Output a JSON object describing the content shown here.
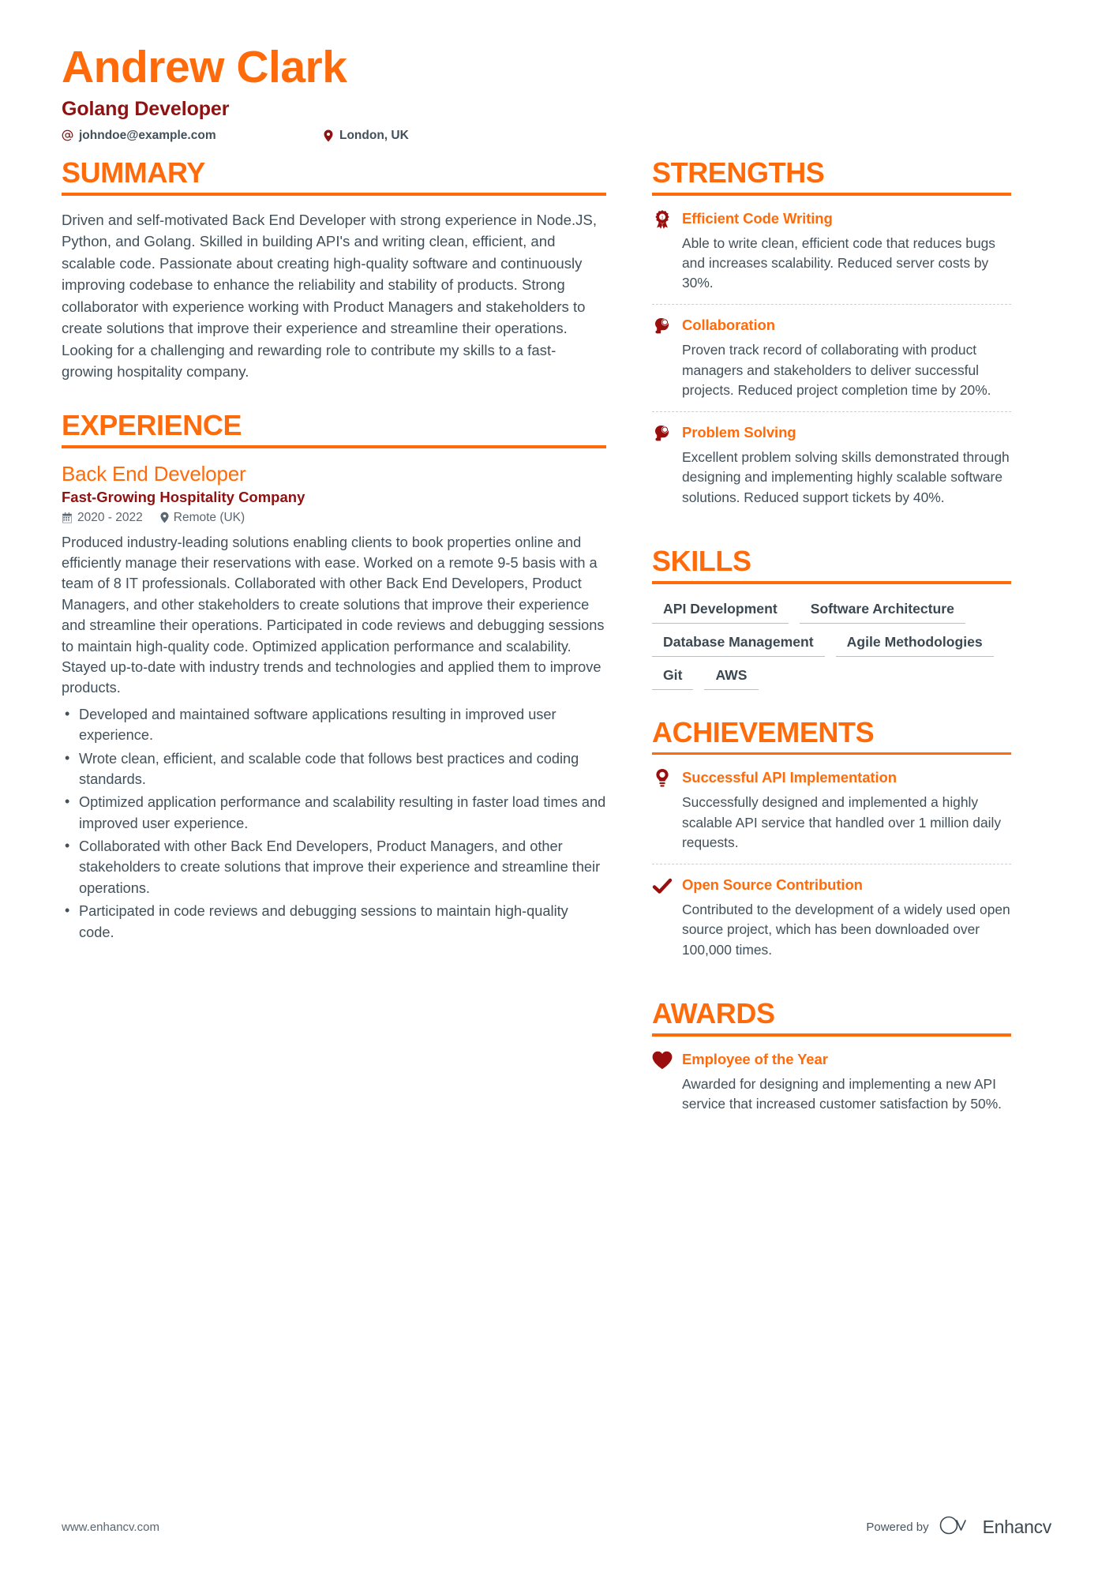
{
  "header": {
    "name": "Andrew Clark",
    "job_title": "Golang Developer",
    "email": "johndoe@example.com",
    "email_icon": "at-sign-icon",
    "location": "London, UK",
    "location_icon": "map-pin-icon"
  },
  "colors": {
    "accent_orange": "#FF6B0B",
    "dark_red": "#8F1111",
    "icon_red": "#9B0E0E",
    "body_text": "#41505A",
    "skill_underline": "#B9BFC4"
  },
  "summary": {
    "heading": "SUMMARY",
    "text": "Driven and self-motivated Back End Developer with strong experience in Node.JS, Python, and Golang. Skilled in building API's and writing clean, efficient, and scalable code. Passionate about creating high-quality software and continuously improving codebase to enhance the reliability and stability of products. Strong collaborator with experience working with Product Managers and stakeholders to create solutions that improve their experience and streamline their operations. Looking for a challenging and rewarding role to contribute my skills to a fast-growing hospitality company."
  },
  "experience": {
    "heading": "EXPERIENCE",
    "jobs": [
      {
        "role": "Back End Developer",
        "company": "Fast-Growing Hospitality Company",
        "dates": "2020 - 2022",
        "dates_icon": "calendar-icon",
        "location": "Remote (UK)",
        "location_icon": "map-pin-icon",
        "description": "Produced industry-leading solutions enabling clients to book properties online and efficiently manage their reservations with ease. Worked on a remote 9-5 basis with a team of 8 IT professionals. Collaborated with other Back End Developers, Product Managers, and other stakeholders to create solutions that improve their experience and streamline their operations. Participated in code reviews and debugging sessions to maintain high-quality code. Optimized application performance and scalability. Stayed up-to-date with industry trends and technologies and applied them to improve products.",
        "bullets": [
          "Developed and maintained software applications resulting in improved user experience.",
          "Wrote clean, efficient, and scalable code that follows best practices and coding standards.",
          "Optimized application performance and scalability resulting in faster load times and improved user experience.",
          "Collaborated with other Back End Developers, Product Managers, and other stakeholders to create solutions that improve their experience and streamline their operations.",
          "Participated in code reviews and debugging sessions to maintain high-quality code."
        ]
      }
    ]
  },
  "strengths": {
    "heading": "STRENGTHS",
    "items": [
      {
        "icon": "award-medal-icon",
        "title": "Efficient Code Writing",
        "text": "Able to write clean, efficient code that reduces bugs and increases scalability. Reduced server costs by 30%."
      },
      {
        "icon": "head-brain-icon",
        "title": "Collaboration",
        "text": "Proven track record of collaborating with product managers and stakeholders to deliver successful projects. Reduced project completion time by 20%."
      },
      {
        "icon": "head-brain-icon",
        "title": "Problem Solving",
        "text": "Excellent problem solving skills demonstrated through designing and implementing highly scalable software solutions. Reduced support tickets by 40%."
      }
    ]
  },
  "skills": {
    "heading": "SKILLS",
    "items": [
      "API Development",
      "Software Architecture",
      "Database Management",
      "Agile Methodologies",
      "Git",
      "AWS"
    ]
  },
  "achievements": {
    "heading": "ACHIEVEMENTS",
    "items": [
      {
        "icon": "lightbulb-icon",
        "title": "Successful API Implementation",
        "text": "Successfully designed and implemented a highly scalable API service that handled over 1 million daily requests."
      },
      {
        "icon": "checkmark-icon",
        "title": "Open Source Contribution",
        "text": "Contributed to the development of a widely used open source project, which has been downloaded over 100,000 times."
      }
    ]
  },
  "awards": {
    "heading": "AWARDS",
    "items": [
      {
        "icon": "heart-icon",
        "title": "Employee of the Year",
        "text": "Awarded for designing and implementing a new API service that increased customer satisfaction by 50%."
      }
    ]
  },
  "footer": {
    "website": "www.enhancv.com",
    "powered_by": "Powered by",
    "brand": "Enhancv",
    "brand_icon": "enhancv-logo-icon"
  }
}
